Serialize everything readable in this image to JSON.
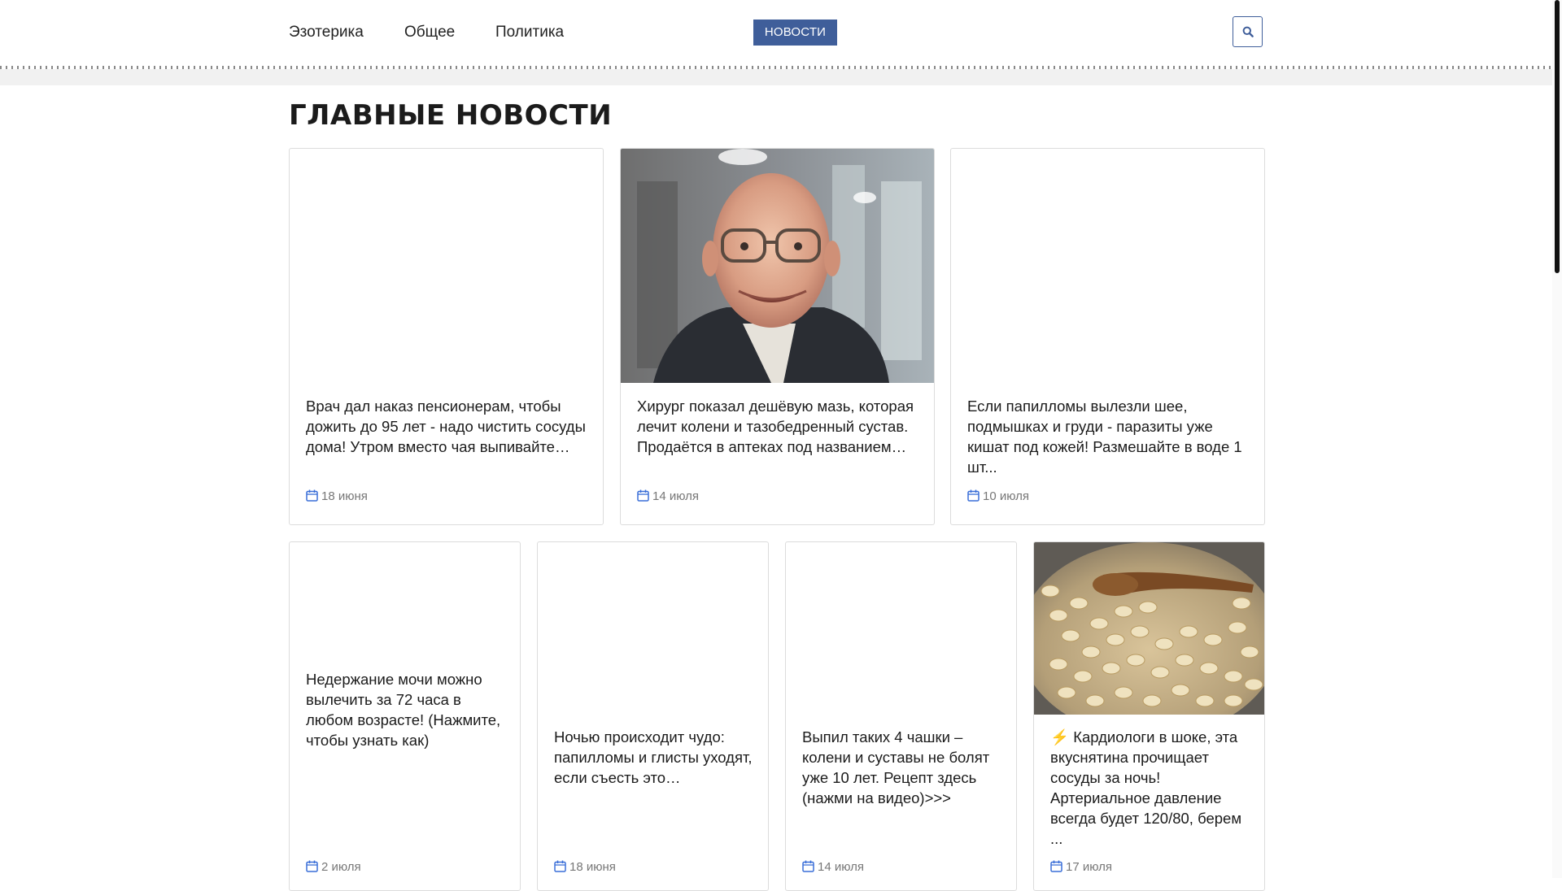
{
  "nav": {
    "links": [
      "Эзотерика",
      "Общее",
      "Политика"
    ],
    "badge": "НОВОСТИ",
    "search_icon": "search-icon"
  },
  "page_title": "ГЛАВНЫЕ НОВОСТИ",
  "colors": {
    "accent": "#3f5e9a",
    "date_icon": "#3a6fd8",
    "text": "#1b1b1b",
    "muted": "#777777"
  },
  "cards": [
    {
      "title": "Врач дал наказ пенсионерам, чтобы дожить до 95 лет - надо чистить сосуды дома! Утром вместо чая выпивайте…",
      "date": "18 июня",
      "image": "none"
    },
    {
      "title": "Хирург показал дешёвую мазь, которая лечит колени и тазобедренный сустав. Продаётся в аптеках под названием…",
      "date": "14 июля",
      "image": "elderly-man-photo"
    },
    {
      "title": "Если папилломы вылезли шее, подмышках и груди - паразиты уже кишат под кожей! Размешайте в воде 1 шт...",
      "date": "10 июля",
      "image": "none"
    },
    {
      "title": "Недержание мочи можно вылечить за 72 часа в любом возрасте! (Нажмите, чтобы узнать как)",
      "date": "2 июля",
      "image": "none"
    },
    {
      "title": "Ночью происходит чудо: папилломы и глисты уходят, если съесть это…",
      "date": "18 июня",
      "image": "none"
    },
    {
      "title": "Выпил таких 4 чашки – колени и суставы не болят уже 10 лет. Рецепт здесь (нажми на видео)>>>",
      "date": "14 июля",
      "image": "none"
    },
    {
      "title": "Кардиологи в шоке, эта вкуснятина прочищает сосуды за ночь! Артериальное давление всегда будет 120/80, берем ...",
      "title_prefix": "⚡",
      "date": "17 июля",
      "image": "garlic-pot-photo"
    }
  ]
}
